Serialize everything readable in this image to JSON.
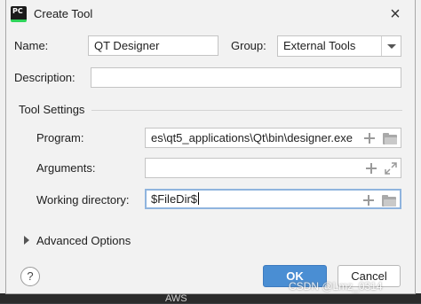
{
  "window": {
    "title": "Create Tool",
    "app_icon_text": "PC"
  },
  "form": {
    "name_label": "Name:",
    "name_value": "QT Designer",
    "group_label": "Group:",
    "group_value": "External Tools",
    "description_label": "Description:",
    "description_value": ""
  },
  "tool_settings": {
    "section_title": "Tool Settings",
    "program_label": "Program:",
    "program_value": "es\\qt5_applications\\Qt\\bin\\designer.exe",
    "arguments_label": "Arguments:",
    "arguments_value": "",
    "working_dir_label": "Working directory:",
    "working_dir_value": "$FileDir$"
  },
  "advanced": {
    "label": "Advanced Options"
  },
  "buttons": {
    "help": "?",
    "ok": "OK",
    "cancel": "Cancel"
  },
  "background": {
    "item": "AWS"
  },
  "watermark": "CSDN @Lmz_0314",
  "colors": {
    "ok_button": "#4a8ed3",
    "focus_border": "#8fb4de",
    "dialog_bg": "#f2f2f2"
  }
}
